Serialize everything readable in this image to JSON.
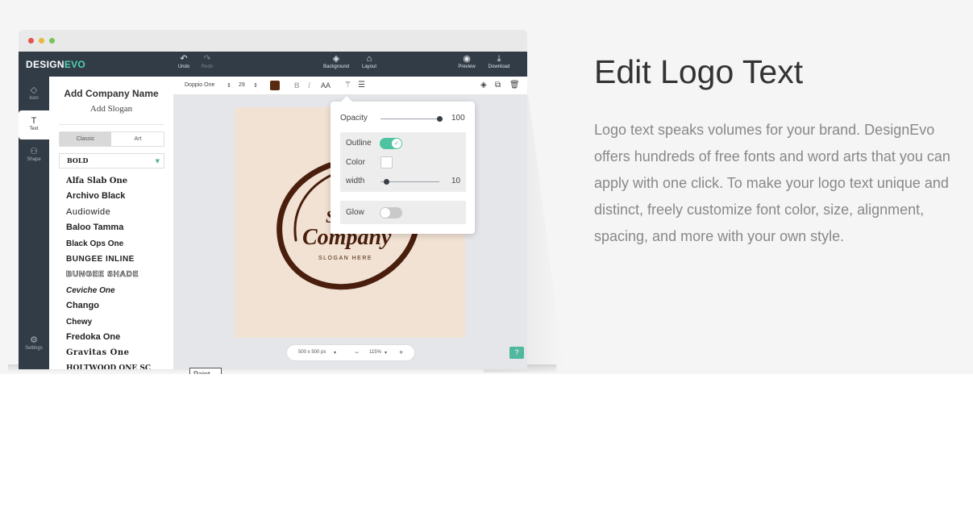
{
  "app": {
    "brand_prefix": "DESIGN",
    "brand_suffix": "EVO"
  },
  "topbar": {
    "undo": "Undo",
    "redo": "Redo",
    "background": "Background",
    "layout": "Layout",
    "preview": "Preview",
    "download": "Download"
  },
  "leftnav": {
    "icon": "Icon",
    "text": "Text",
    "shape": "Shape",
    "settings": "Settings"
  },
  "panel": {
    "company": "Add Company Name",
    "slogan": "Add Slogan",
    "tab_classic": "Classic",
    "tab_art": "Art",
    "selected_style": "BOLD",
    "fonts": [
      "Alfa Slab One",
      "Archivo Black",
      "Audiowide",
      "Baloo Tamma",
      "Black Ops One",
      "BUNGEE INLINE",
      "BUNGEE SHADE",
      "Ceviche One",
      "Chango",
      "Chewy",
      "Fredoka One",
      "Gravitas One",
      "HOLTWOOD ONE SC"
    ]
  },
  "toolbar": {
    "font_name": "Doppio One",
    "font_size": "29",
    "bold": "B",
    "italic": "I",
    "case": "AA",
    "text_color": "#5a2a10"
  },
  "canvas": {
    "logo_text": "Company",
    "logo_letter": "S",
    "logo_slogan": "SLOGAN HERE",
    "size_label": "500 x 500 px",
    "zoom": "115%",
    "minus": "−",
    "plus": "+",
    "help": "?",
    "logo_color": "#4a1e0c",
    "bg_color": "#f1e2d3"
  },
  "popup": {
    "opacity_label": "Opacity",
    "opacity_value": "100",
    "outline_label": "Outline",
    "color_label": "Color",
    "width_label": "width",
    "width_value": "10",
    "glow_label": "Glow",
    "outline_on": true,
    "glow_on": false,
    "accent": "#4fc3a1"
  },
  "tooltip": {
    "text": "Paint"
  },
  "feature": {
    "title": "Edit Logo Text",
    "description": "Logo text speaks volumes for your brand. DesignEvo offers hundreds of free fonts and word arts that you can apply with one click. To make your logo text unique and distinct, freely customize font color, size, alignment, spacing, and more with your own style."
  }
}
